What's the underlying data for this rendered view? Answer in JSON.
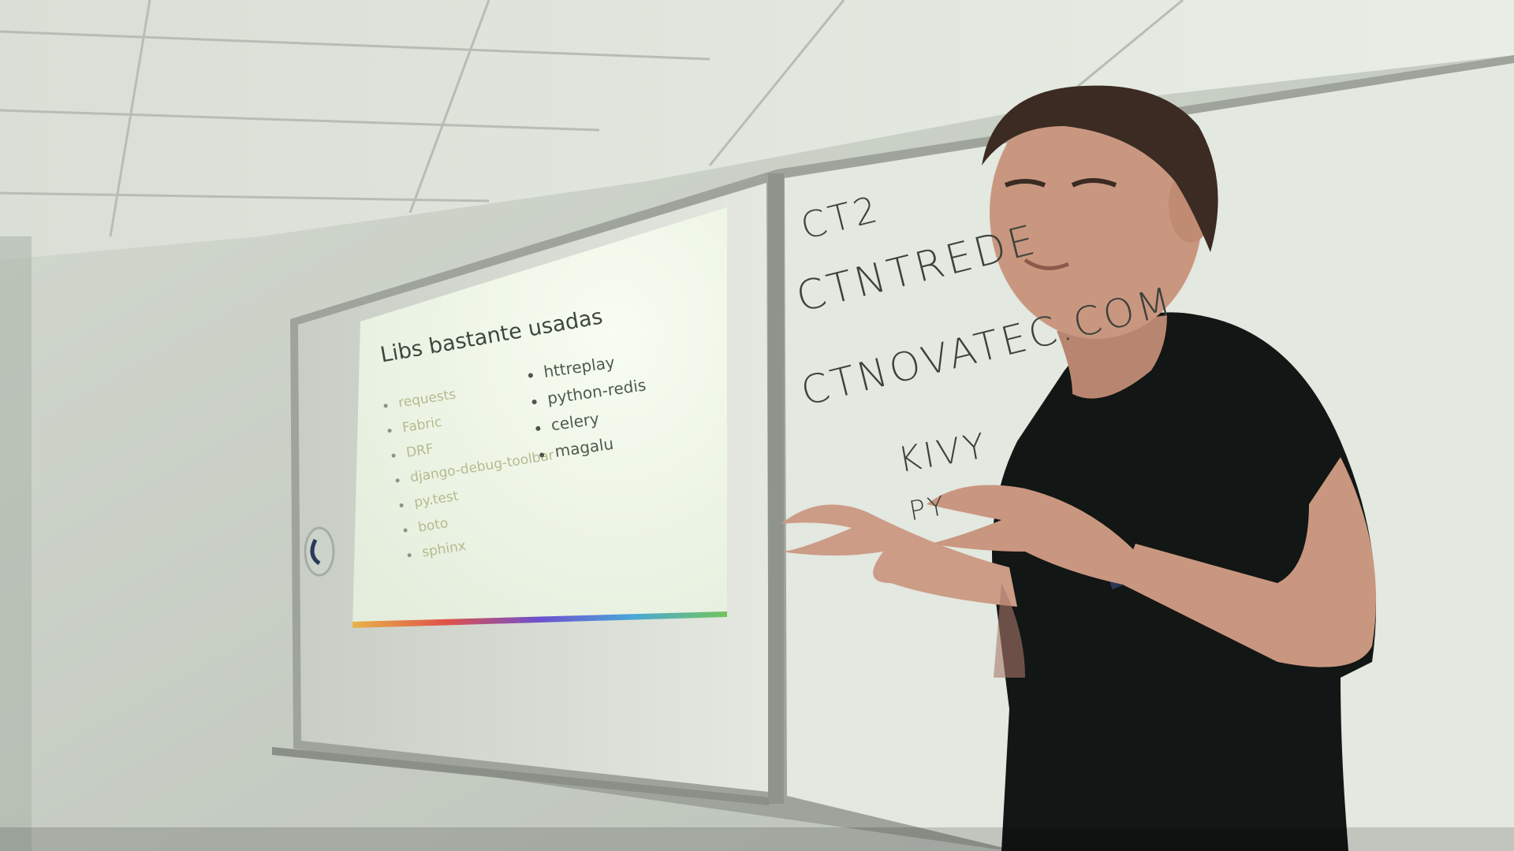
{
  "colors": {
    "wall": "#c9cfc6",
    "ceiling": "#dfe5dd",
    "projected_screen": "#eef6e9",
    "whiteboard": "#dfe4dc",
    "shirt": "#111513",
    "skin": "#c9967e",
    "hair": "#3a2a22"
  },
  "slide": {
    "title": "Libs bastante usadas",
    "column_1": [
      "requests",
      "Fabric",
      "DRF",
      "django-debug-toolbar",
      "py.test",
      "boto",
      "sphinx"
    ],
    "column_2": [
      "httreplay",
      "python-redis",
      "celery",
      "magalu"
    ]
  },
  "whiteboard": {
    "lines": [
      "CT2",
      "CTNTREDE",
      "CTNOVATEC.COM",
      "KIVY",
      "PY"
    ]
  }
}
